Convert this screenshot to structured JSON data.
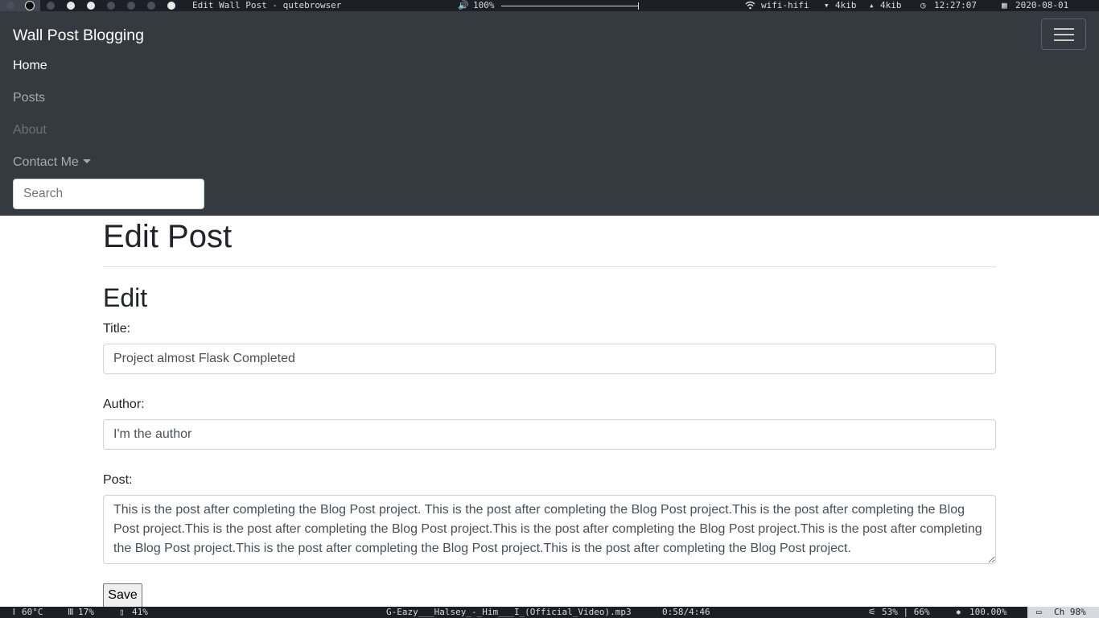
{
  "system_top": {
    "window_title": "Edit Wall Post - qutebrowser",
    "volume": "100%",
    "wifi": "wifi-hifi",
    "down": "4kib",
    "up": "4kib",
    "time": "12:27:07",
    "date": "2020-08-01",
    "icons": {
      "volume": "speaker-icon",
      "wifi": "wifi-icon",
      "down": "download-arrow-icon",
      "up": "upload-arrow-icon",
      "clock": "clock-icon",
      "calendar": "calendar-icon"
    }
  },
  "navbar": {
    "brand": "Wall Post Blogging",
    "links": {
      "home": "Home",
      "posts": "Posts",
      "about": "About",
      "contact": "Contact Me"
    },
    "search_placeholder": "Search"
  },
  "main": {
    "page_title": "Edit Post",
    "section_title": "Edit",
    "title_label": "Title:",
    "title_value": "Project almost Flask Completed",
    "author_label": "Author:",
    "author_value": "I'm the author",
    "post_label": "Post:",
    "post_value": "This is the post after completing the Blog Post project. This is the post after completing the Blog Post project.This is the post after completing the Blog Post project.This is the post after completing the Blog Post project.This is the post after completing the Blog Post project.This is the post after completing the Blog Post project.This is the post after completing the Blog Post project.This is the post after completing the Blog Post project.",
    "save_label": "Save"
  },
  "system_bottom": {
    "temp": "60°C",
    "cpu": "17%",
    "mem": "41%",
    "track": "G-Eazy___Halsey_-_Him___I_(Official_Video).mp3",
    "track_time": "0:58/4:46",
    "levels": "53% | 66%",
    "brightness": "100.00%",
    "kbd": "Ch 98%"
  },
  "colors": {
    "navbar_bg": "#343a40",
    "system_bar_bg": "#1c1f26",
    "text_dark": "#212529",
    "border": "#ced4da"
  }
}
